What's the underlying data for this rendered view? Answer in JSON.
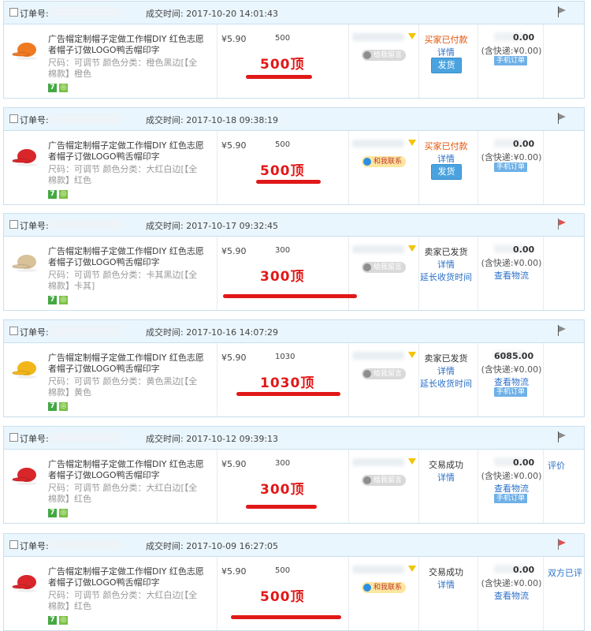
{
  "labels": {
    "order_no": "订单号:",
    "deal_time_prefix": "成交时间: ",
    "product_name": "广告帽定制帽子定做工作帽DIY 红色志愿者帽子订做LOGO鸭舌帽印字",
    "price": "¥5.90",
    "leave_message": "给我留言",
    "contact_me": "和我联系",
    "details": "详情",
    "ship": "发货",
    "extend_receipt": "延长收货时间",
    "view_logistics": "查看物流",
    "shipping_fee": "(含快递:¥0.00)",
    "mobile_order": "手机订单",
    "amount_suffix": ".00"
  },
  "orders": [
    {
      "time": "2017-10-20 14:01:43",
      "qty": "500",
      "big": "500顶",
      "attr": "尺码：可调节   颜色分类：橙色黑边[【全棉款】橙色",
      "status": "买家已付款",
      "status_type": "paid",
      "action": "",
      "msg": "leave",
      "cap_color": "#f07a22",
      "flag": "gray",
      "amount_tail": "0.00",
      "mobile": true
    },
    {
      "time": "2017-10-18 09:38:19",
      "qty": "500",
      "big": "500顶",
      "attr": "尺码：可调节   颜色分类：大红白边[【全棉款】红色",
      "status": "买家已付款",
      "status_type": "paid",
      "action": "",
      "msg": "contact",
      "cap_color": "#d8262a",
      "flag": "gray",
      "amount_tail": "0.00",
      "mobile": true
    },
    {
      "time": "2017-10-17 09:32:45",
      "qty": "300",
      "big": "300顶",
      "attr": "尺码：可调节   颜色分类：卡其黑边[【全棉款】卡其]",
      "status": "卖家已发货",
      "status_type": "shipped",
      "action": "",
      "msg": "leave",
      "cap_color": "#d9c19a",
      "flag": "red",
      "amount_tail": "0.00",
      "mobile": false
    },
    {
      "time": "2017-10-16 14:07:29",
      "qty": "1030",
      "big": "1030顶",
      "attr": "尺码：可调节   颜色分类：黄色黑边[【全棉款】黄色",
      "status": "卖家已发货",
      "status_type": "shipped",
      "action": "",
      "msg": "leave",
      "cap_color": "#f2b61b",
      "flag": "gray",
      "amount_tail": "6085.00",
      "mobile": true
    },
    {
      "time": "2017-10-12 09:39:13",
      "qty": "300",
      "big": "300顶",
      "attr": "尺码：可调节   颜色分类：大红白边[【全棉款】红色",
      "status": "交易成功",
      "status_type": "done",
      "action": "评价",
      "msg": "leave",
      "cap_color": "#d8262a",
      "flag": "gray",
      "amount_tail": "0.00",
      "mobile": true
    },
    {
      "time": "2017-10-09 16:27:05",
      "qty": "500",
      "big": "500顶",
      "attr": "尺码：可调节   颜色分类：大红白边[【全棉款】红色",
      "status": "交易成功",
      "status_type": "done",
      "action": "双方已评",
      "msg": "contact",
      "cap_color": "#d8262a",
      "flag": "red",
      "amount_tail": "0.00",
      "mobile": false
    }
  ]
}
